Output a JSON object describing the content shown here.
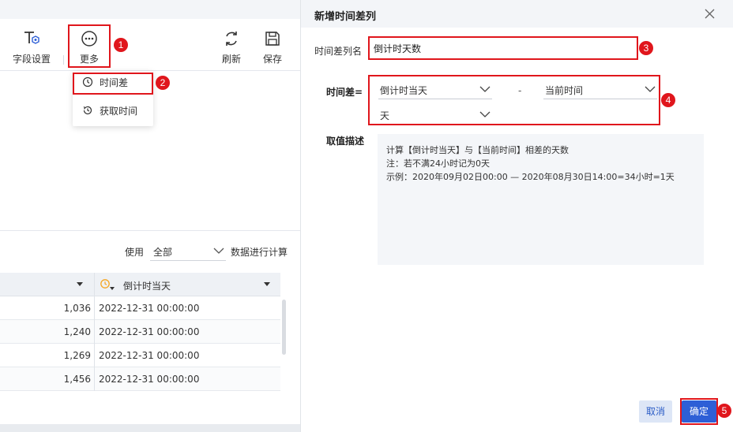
{
  "toolbar": {
    "field_settings_label": "字段设置",
    "more_label": "更多",
    "refresh_label": "刷新",
    "save_label": "保存"
  },
  "more_menu": {
    "items": [
      {
        "label": "时间差",
        "icon": "clock-icon"
      },
      {
        "label": "获取时间",
        "icon": "clock-history-icon"
      }
    ]
  },
  "compute": {
    "prefix": "使用",
    "scope_value": "全部",
    "suffix": "数据进行计算"
  },
  "grid": {
    "date_column_title": "倒计时当天",
    "rows": [
      {
        "num": "1,036",
        "date": "2022-12-31 00:00:00"
      },
      {
        "num": "1,240",
        "date": "2022-12-31 00:00:00"
      },
      {
        "num": "1,269",
        "date": "2022-12-31 00:00:00"
      },
      {
        "num": "1,456",
        "date": "2022-12-31 00:00:00"
      }
    ]
  },
  "dialog": {
    "title": "新增时间差列",
    "name_label": "时间差列名",
    "name_value": "倒计时天数",
    "diff_label": "时间差=",
    "start_value": "倒计时当天",
    "separator": "-",
    "end_value": "当前时间",
    "unit_value": "天",
    "desc_label": "取值描述",
    "desc_lines": [
      "计算【倒计时当天】与【当前时间】相差的天数",
      "注：若不满24小时记为0天",
      "示例：2020年09月02日00:00 — 2020年08月30日14:00=34小时=1天"
    ],
    "cancel_label": "取消",
    "ok_label": "确定"
  },
  "annotations": [
    "1",
    "2",
    "3",
    "4",
    "5"
  ],
  "colors": {
    "highlight": "#e0161c",
    "primary": "#2e5fd6",
    "accent_orange": "#f5a623"
  }
}
